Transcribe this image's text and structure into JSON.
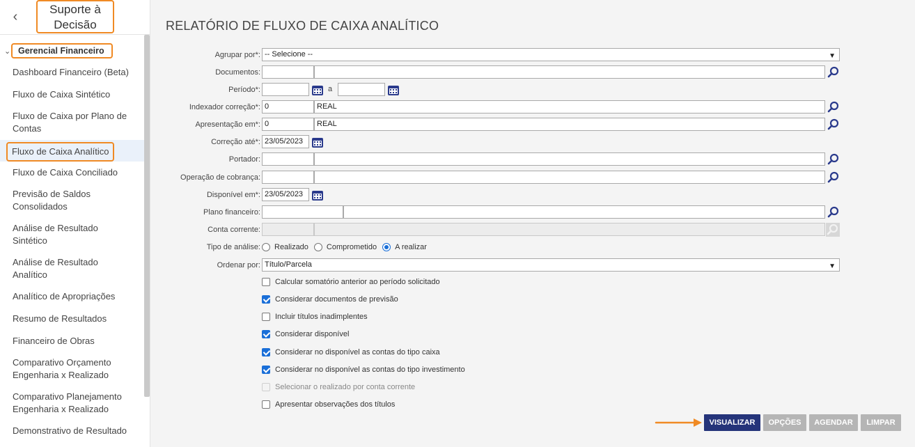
{
  "sidebar": {
    "title_line1": "Suporte à",
    "title_line2": "Decisão",
    "group": "Gerencial Financeiro",
    "items": [
      {
        "label": "Dashboard Financeiro (Beta)"
      },
      {
        "label": "Fluxo de Caixa Sintético"
      },
      {
        "label": "Fluxo de Caixa por Plano de",
        "label2": "Contas"
      },
      {
        "label": "Fluxo de Caixa Analítico"
      },
      {
        "label": "Fluxo de Caixa Conciliado"
      },
      {
        "label": "Previsão de Saldos",
        "label2": "Consolidados"
      },
      {
        "label": "Análise de Resultado",
        "label2": "Sintético"
      },
      {
        "label": "Análise de Resultado",
        "label2": "Analítico"
      },
      {
        "label": "Analítico de Apropriações"
      },
      {
        "label": "Resumo de Resultados"
      },
      {
        "label": "Financeiro de Obras"
      },
      {
        "label": "Comparativo Orçamento",
        "label2": "Engenharia x Realizado"
      },
      {
        "label": "Comparativo Planejamento",
        "label2": "Engenharia x Realizado"
      },
      {
        "label": "Demonstrativo de Resultado"
      }
    ]
  },
  "page": {
    "title": "RELATÓRIO DE FLUXO DE CAIXA ANALÍTICO"
  },
  "form": {
    "agrupar_label": "Agrupar por*:",
    "agrupar_value": "-- Selecione --",
    "documentos_label": "Documentos:",
    "periodo_label": "Período*:",
    "periodo_sep": "a",
    "indexador_label": "Indexador correção*:",
    "indexador_code": "0",
    "indexador_name": "REAL",
    "apresentacao_label": "Apresentação em*:",
    "apresentacao_code": "0",
    "apresentacao_name": "REAL",
    "correcao_label": "Correção até*:",
    "correcao_value": "23/05/2023",
    "portador_label": "Portador:",
    "operacao_label": "Operação de cobrança:",
    "disponivel_label": "Disponível em*:",
    "disponivel_value": "23/05/2023",
    "plano_label": "Plano financeiro:",
    "conta_label": "Conta corrente:",
    "tipo_label": "Tipo de análise:",
    "tipo_options": [
      "Realizado",
      "Comprometido",
      "A realizar"
    ],
    "ordenar_label": "Ordenar por:",
    "ordenar_value": "Título/Parcela",
    "checkboxes": [
      "Calcular somatório anterior ao período solicitado",
      "Considerar documentos de previsão",
      "Incluir títulos inadimplentes",
      "Considerar disponível",
      "Considerar no disponível as contas do tipo caixa",
      "Considerar no disponível as contas do tipo investimento",
      "Selecionar o realizado por conta corrente",
      "Apresentar observações dos títulos"
    ]
  },
  "buttons": {
    "visualizar": "VISUALIZAR",
    "opcoes": "OPÇÕES",
    "agendar": "AGENDAR",
    "limpar": "LIMPAR"
  },
  "colors": {
    "accent": "#f08a24",
    "primary": "#25347a",
    "checkbox": "#1a6fd8"
  }
}
